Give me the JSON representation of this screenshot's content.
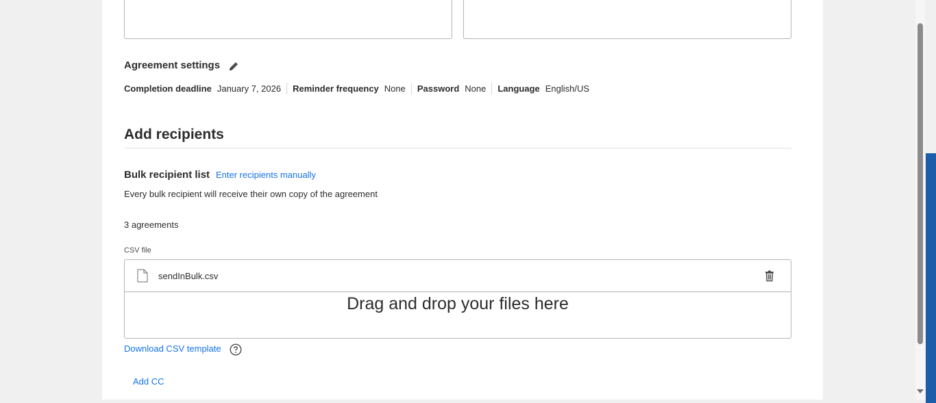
{
  "agreement_settings": {
    "title": "Agreement settings",
    "items": [
      {
        "label": "Completion deadline",
        "value": "January 7, 2026"
      },
      {
        "label": "Reminder frequency",
        "value": "None"
      },
      {
        "label": "Password",
        "value": "None"
      },
      {
        "label": "Language",
        "value": "English/US"
      }
    ]
  },
  "recipients": {
    "section_title": "Add recipients",
    "bulk_title": "Bulk recipient list",
    "manual_link": "Enter recipients manually",
    "description": "Every bulk recipient will receive their own copy of the agreement",
    "agreements_count": "3 agreements",
    "csv_label": "CSV file",
    "file_name": "sendInBulk.csv",
    "drop_text": "Drag and drop your files here",
    "download_link": "Download CSV template",
    "add_cc": "Add CC"
  },
  "colors": {
    "link": "#1473e6",
    "accent_strip": "#1b5da8"
  },
  "icons": [
    "pencil-icon",
    "file-icon",
    "trash-icon",
    "help-icon",
    "chevron-down-icon"
  ]
}
